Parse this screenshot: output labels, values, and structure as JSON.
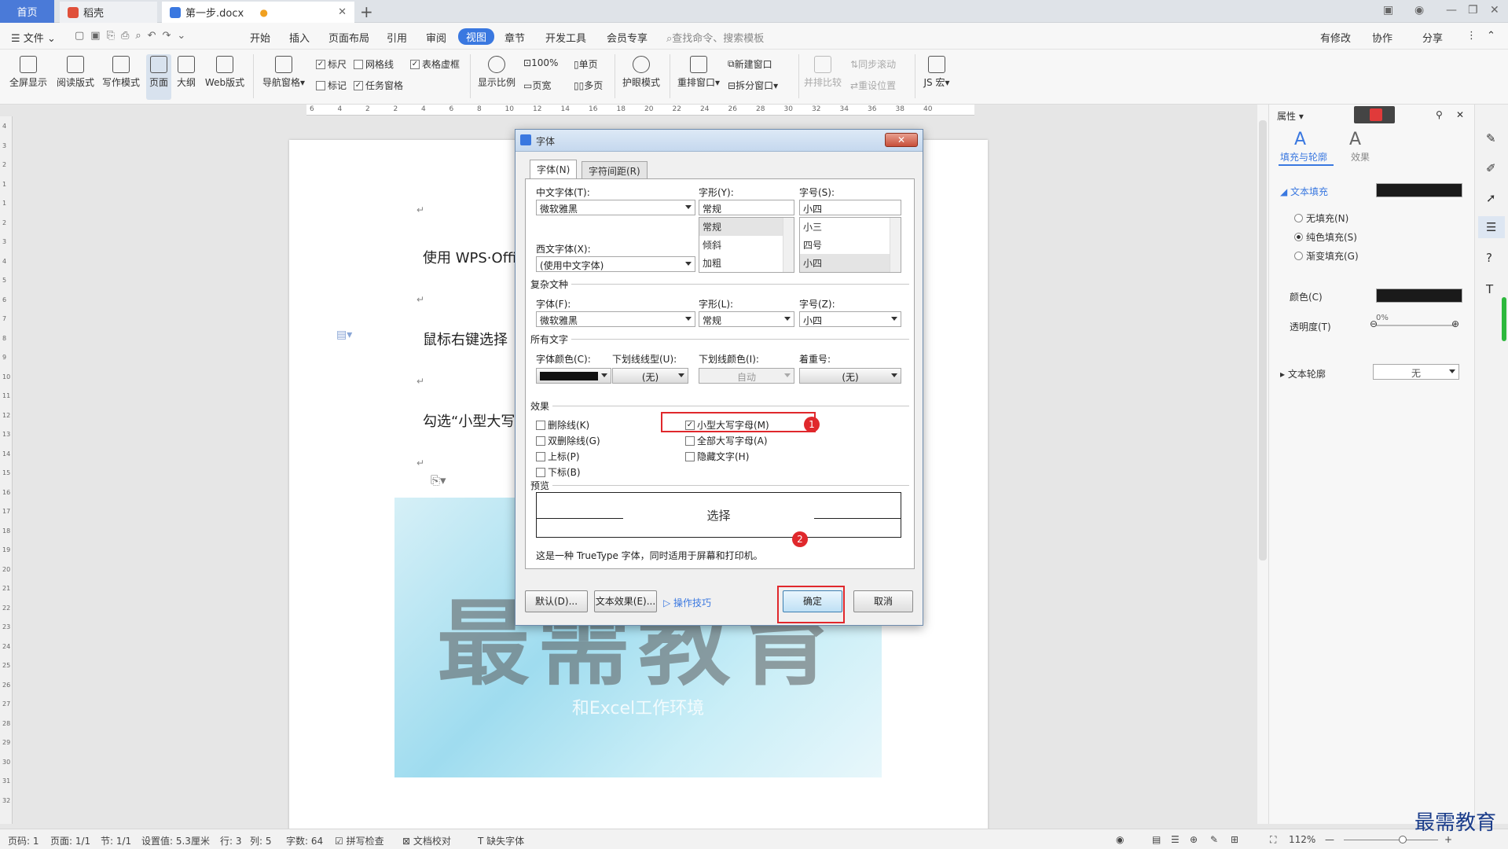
{
  "tabs": {
    "home": "首页",
    "daoke": "稻壳",
    "doc": "第一步.docx"
  },
  "menu": {
    "file": "文件",
    "items": [
      "开始",
      "插入",
      "页面布局",
      "引用",
      "审阅",
      "视图",
      "章节",
      "开发工具",
      "会员专享"
    ],
    "search": "查找命令、搜索模板",
    "right": [
      "有修改",
      "协作",
      "分享"
    ]
  },
  "ribbon": {
    "fullscreen": "全屏显示",
    "read": "阅读版式",
    "write": "写作模式",
    "page": "页面",
    "outline": "大纲",
    "web": "Web版式",
    "nav": "导航窗格",
    "ruler": "标尺",
    "grid": "网格线",
    "table_grid": "表格虚框",
    "mark": "标记",
    "task": "任务窗格",
    "zoom": "显示比例",
    "pct": "100%",
    "pagewidth": "页宽",
    "single": "单页",
    "multi": "多页",
    "eye": "护眼模式",
    "rearrange": "重排窗口",
    "newwin": "新建窗口",
    "split": "拆分窗口",
    "compare": "并排比较",
    "syncscroll": "同步滚动",
    "resetpos": "重设位置",
    "macro": "JS 宏"
  },
  "ruler_numbers": [
    "6",
    "4",
    "2",
    "2",
    "4",
    "6",
    "8",
    "10",
    "12",
    "14",
    "16",
    "18",
    "20",
    "22",
    "24",
    "26",
    "28",
    "30",
    "32",
    "34",
    "36",
    "38",
    "40"
  ],
  "vruler_numbers": [
    "4",
    "3",
    "2",
    "1",
    "1",
    "2",
    "3",
    "4",
    "5",
    "6",
    "7",
    "8",
    "9",
    "10",
    "11",
    "12",
    "13",
    "14",
    "15",
    "16",
    "17",
    "18",
    "19",
    "20",
    "21",
    "22",
    "23",
    "24",
    "25",
    "26",
    "27",
    "28",
    "29",
    "30",
    "31",
    "32"
  ],
  "document": {
    "line1": "使用 WPS·Offi",
    "line2": "鼠标右键选择",
    "line3": "勾选“小型大写",
    "watermark": "最需教育",
    "watermark_sub": "和Excel工作环境"
  },
  "dialog": {
    "title": "字体",
    "tab_font": "字体(N)",
    "tab_spacing": "字符间距(R)",
    "cn_font_label": "中文字体(T):",
    "cn_font_value": "微软雅黑",
    "style_label": "字形(Y):",
    "style_value": "常规",
    "size_label": "字号(S):",
    "size_value": "小四",
    "style_list": [
      "常规",
      "倾斜",
      "加粗"
    ],
    "size_list": [
      "小三",
      "四号",
      "小四"
    ],
    "west_font_label": "西文字体(X):",
    "west_font_value": "(使用中文字体)",
    "complex_group": "复杂文种",
    "c_font_label": "字体(F):",
    "c_font_value": "微软雅黑",
    "c_style_label": "字形(L):",
    "c_style_value": "常规",
    "c_size_label": "字号(Z):",
    "c_size_value": "小四",
    "all_group": "所有文字",
    "color_label": "字体颜色(C):",
    "underline_label": "下划线线型(U):",
    "underline_value": "(无)",
    "ul_color_label": "下划线颜色(I):",
    "ul_color_value": "自动",
    "emphasis_label": "着重号:",
    "emphasis_value": "(无)",
    "effects_group": "效果",
    "effects_left": [
      "删除线(K)",
      "双删除线(G)",
      "上标(P)",
      "下标(B)"
    ],
    "effects_right": [
      "小型大写字母(M)",
      "全部大写字母(A)",
      "隐藏文字(H)"
    ],
    "preview_group": "预览",
    "preview_text": "选择",
    "preview_note": "这是一种 TrueType 字体，同时适用于屏幕和打印机。",
    "btn_default": "默认(D)...",
    "btn_effects": "文本效果(E)...",
    "link_tips": "操作技巧",
    "btn_ok": "确定",
    "btn_cancel": "取消",
    "close": "✕",
    "badge1": "1",
    "badge2": "2"
  },
  "panel": {
    "title": "属性",
    "tab_fill": "填充与轮廓",
    "tab_effect": "效果",
    "text_fill": "文本填充",
    "no_fill": "无填充(N)",
    "solid_fill": "纯色填充(S)",
    "gradient_fill": "渐变填充(G)",
    "color": "颜色(C)",
    "transparency": "透明度(T)",
    "transparency_value": "0%",
    "outline": "文本轮廓",
    "outline_value": "无"
  },
  "status": {
    "page": "页码: 1",
    "pages": "页面: 1/1",
    "section": "节: 1/1",
    "setting": "设置值: 5.3厘米",
    "row": "行: 3",
    "col": "列: 5",
    "words": "字数: 64",
    "spell": "拼写检查",
    "proof": "文档校对",
    "missing_font": "缺失字体",
    "zoom": "112%"
  },
  "corner_logo": "最需教育",
  "colors": {
    "accent": "#3a78e0",
    "highlight": "#e0282c"
  }
}
